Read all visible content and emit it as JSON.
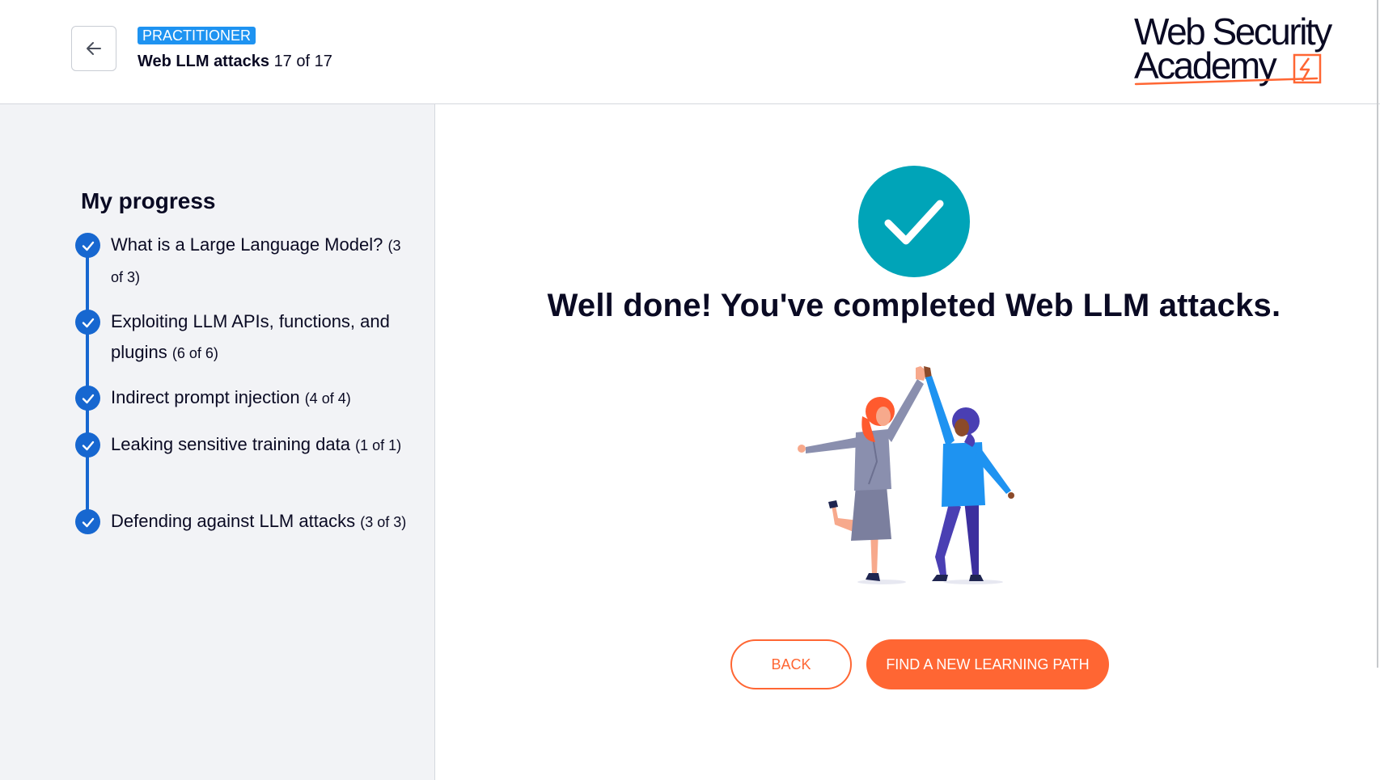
{
  "header": {
    "badge": "PRACTITIONER",
    "course_name": "Web LLM attacks",
    "course_position": "17 of 17",
    "logo_line1": "Web Security",
    "logo_line2": "Academy",
    "back_icon": "arrow-left-icon"
  },
  "sidebar": {
    "title": "My progress",
    "items": [
      {
        "label": "What is a Large Language Model?",
        "count": "(3 of 3)"
      },
      {
        "label": "Exploiting LLM APIs, functions, and plugins",
        "count": "(6 of 6)"
      },
      {
        "label": "Indirect prompt injection",
        "count": "(4 of 4)"
      },
      {
        "label": "Leaking sensitive training data",
        "count": "(1 of 1)"
      },
      {
        "label": "Defending against LLM attacks",
        "count": "(3 of 3)"
      }
    ]
  },
  "main": {
    "headline": "Well done! You've completed Web LLM attacks.",
    "back_label": "BACK",
    "find_label": "FIND A NEW LEARNING PATH"
  },
  "colors": {
    "accent": "#ff6633",
    "progress": "#1767d0",
    "success": "#00a4b8",
    "badge": "#1e93f1"
  }
}
